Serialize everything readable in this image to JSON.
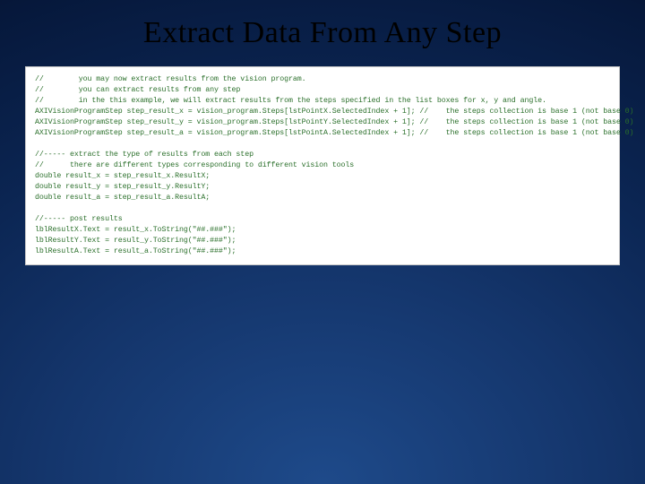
{
  "title": "Extract Data From Any Step",
  "code": {
    "line1": "//        you may now extract results from the vision program.",
    "line2": "//        you can extract results from any step",
    "line3": "//        in the this example, we will extract results from the steps specified in the list boxes for x, y and angle.",
    "line4": "AXIVisionProgramStep step_result_x = vision_program.Steps[lstPointX.SelectedIndex + 1]; //    the steps collection is base 1 (not base 0)",
    "line5": "AXIVisionProgramStep step_result_y = vision_program.Steps[lstPointY.SelectedIndex + 1]; //    the steps collection is base 1 (not base 0)",
    "line6": "AXIVisionProgramStep step_result_a = vision_program.Steps[lstPointA.SelectedIndex + 1]; //    the steps collection is base 1 (not base 0)",
    "line7": "",
    "line8": "//----- extract the type of results from each step",
    "line9": "//      there are different types corresponding to different vision tools",
    "line10": "double result_x = step_result_x.ResultX;",
    "line11": "double result_y = step_result_y.ResultY;",
    "line12": "double result_a = step_result_a.ResultA;",
    "line13": "",
    "line14": "//----- post results",
    "line15": "lblResultX.Text = result_x.ToString(\"##.###\");",
    "line16": "lblResultY.Text = result_y.ToString(\"##.###\");",
    "line17": "lblResultA.Text = result_a.ToString(\"##.###\");"
  }
}
